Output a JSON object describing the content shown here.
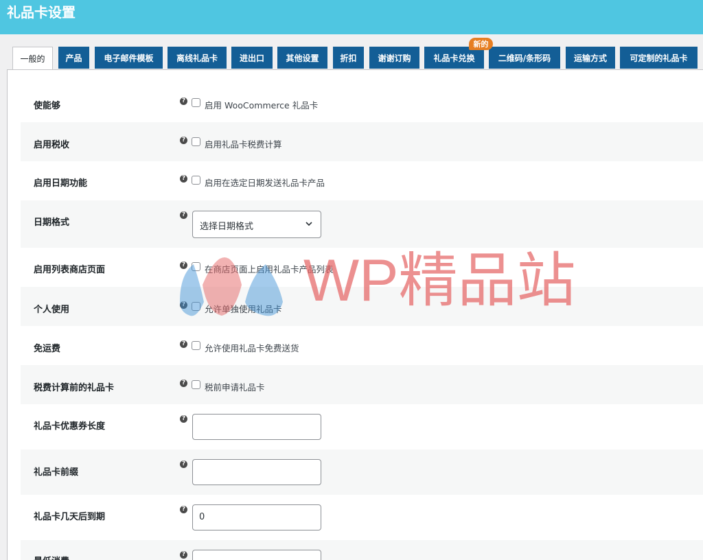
{
  "header": {
    "title": "礼品卡设置"
  },
  "tabs": [
    {
      "label": "一般的",
      "active": true
    },
    {
      "label": "产品"
    },
    {
      "label": "电子邮件模板"
    },
    {
      "label": "离线礼品卡"
    },
    {
      "label": "进出口"
    },
    {
      "label": "其他设置"
    },
    {
      "label": "折扣"
    },
    {
      "label": "谢谢订购"
    },
    {
      "label": "礼品卡兑换",
      "badge": "新的"
    },
    {
      "label": "二维码/条形码"
    },
    {
      "label": "运输方式"
    },
    {
      "label": "可定制的礼品卡"
    }
  ],
  "settings": {
    "enable": {
      "label": "使能够",
      "checkbox_label": "启用 WooCommerce 礼品卡",
      "checked": false
    },
    "tax": {
      "label": "启用税收",
      "checkbox_label": "启用礼品卡税费计算",
      "checked": false
    },
    "date_feature": {
      "label": "启用日期功能",
      "checkbox_label": "启用在选定日期发送礼品卡产品",
      "checked": false
    },
    "date_format": {
      "label": "日期格式",
      "selected": "选择日期格式"
    },
    "shop_listing": {
      "label": "启用列表商店页面",
      "checkbox_label": "在商店页面上启用礼品卡产品列表",
      "checked": false
    },
    "individual_use": {
      "label": "个人使用",
      "checkbox_label": "允许单独使用礼品卡",
      "checked": false
    },
    "free_shipping": {
      "label": "免运费",
      "checkbox_label": "允许使用礼品卡免费送货",
      "checked": false
    },
    "before_tax": {
      "label": "税费计算前的礼品卡",
      "checkbox_label": "税前申请礼品卡",
      "checked": false
    },
    "coupon_length": {
      "label": "礼品卡优惠券长度",
      "value": ""
    },
    "prefix": {
      "label": "礼品卡前缀",
      "value": ""
    },
    "expiry_days": {
      "label": "礼品卡几天后到期",
      "value": "0"
    },
    "min_spend": {
      "label": "最低消费",
      "value": ""
    }
  },
  "help_glyph": "?",
  "icons": {
    "help": "question-circle-icon",
    "dropdown": "chevron-down-icon"
  },
  "colors": {
    "header": "#4fc6e1",
    "tab": "#135e96",
    "badge": "#e67e22",
    "watermark": "#e56767"
  },
  "watermark": {
    "text": "WP精品站"
  }
}
